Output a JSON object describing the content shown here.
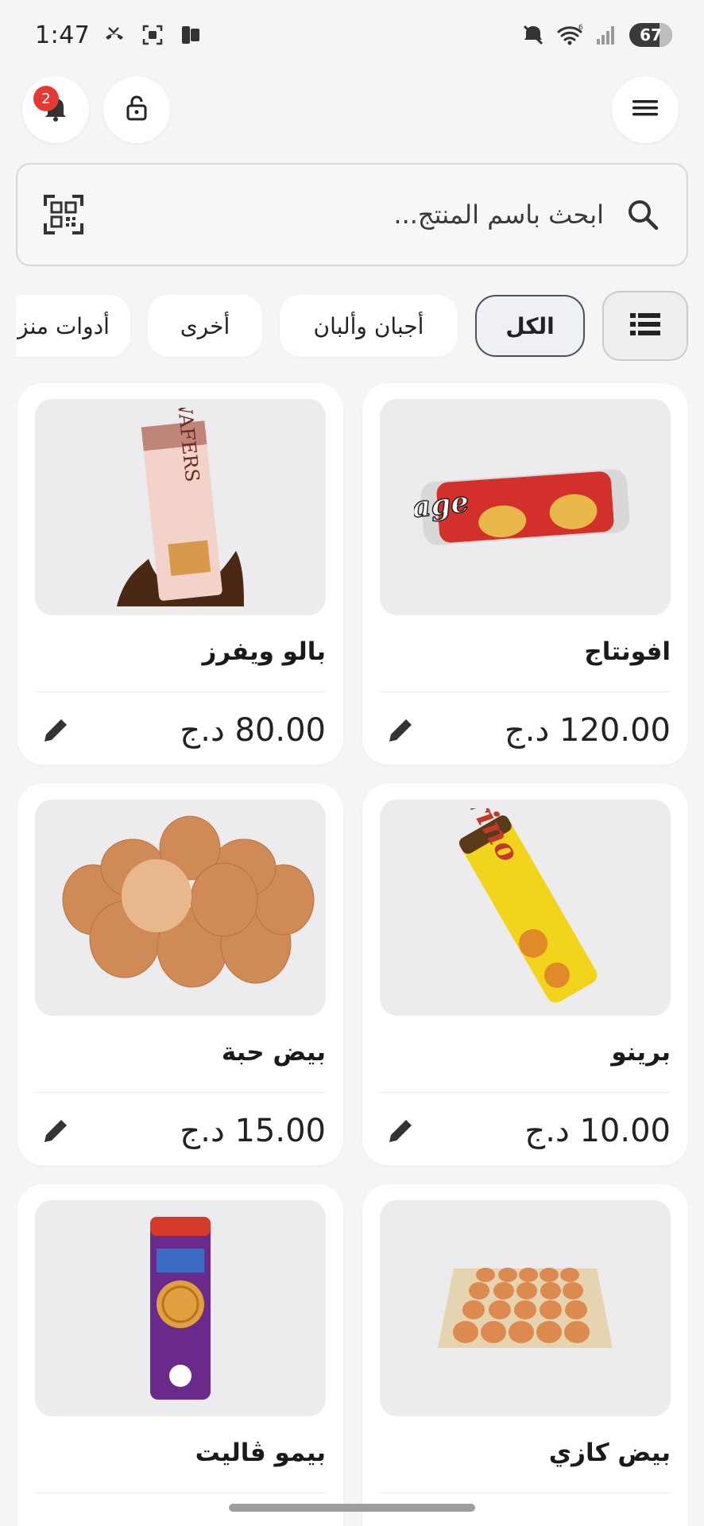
{
  "status_bar": {
    "time": "1:47",
    "battery": "67",
    "signal_label": "6"
  },
  "toolbar": {
    "notification_count": "2"
  },
  "search": {
    "placeholder": "ابحث باسم المنتج..."
  },
  "categories": [
    {
      "label": "الكل",
      "active": true
    },
    {
      "label": "أجبان وألبان",
      "active": false
    },
    {
      "label": "أخرى",
      "active": false
    },
    {
      "label": "أدوات منزلية",
      "active": false
    }
  ],
  "products": [
    {
      "name": "افونتاج",
      "price": "120.00 د.ج",
      "image": "avantage-biscuit-pack"
    },
    {
      "name": "بالو ويفرز",
      "price": "80.00 د.ج",
      "image": "palo-wafers-pack"
    },
    {
      "name": "برينو",
      "price": "10.00 د.ج",
      "image": "brino-biscuit-roll"
    },
    {
      "name": "بيض حبة",
      "price": "15.00 د.ج",
      "image": "eggs-pile"
    },
    {
      "name": "بيض كازي",
      "price": "",
      "image": "egg-tray"
    },
    {
      "name": "بيمو ڤاليت",
      "price": "",
      "image": "bimo-galette-pack"
    }
  ],
  "colors": {
    "accent": "#4a5260",
    "badge": "#e53935",
    "card_bg": "#ffffff",
    "page_bg": "#f5f5f5"
  }
}
